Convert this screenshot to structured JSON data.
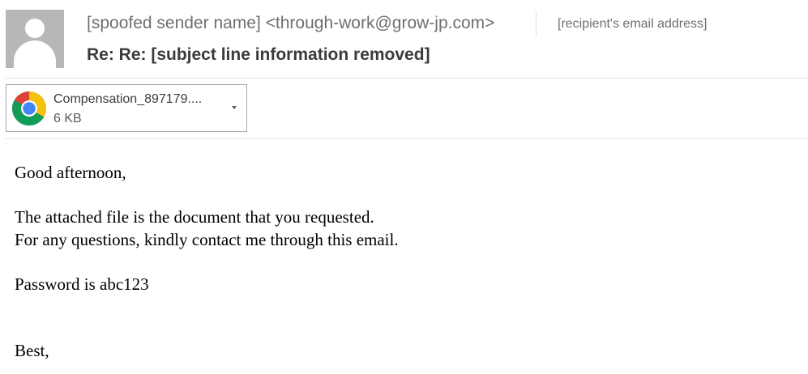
{
  "header": {
    "sender": "[spoofed sender name] <through-work@grow-jp.com>",
    "recipient": "[recipient's email address]",
    "subject": "Re: Re: [subject line information removed]"
  },
  "attachment": {
    "filename": "Compensation_897179....",
    "size": "6 KB",
    "icon": "chrome-icon"
  },
  "body": {
    "greeting": "Good afternoon,",
    "line1": "The attached file is the document that you requested.",
    "line2": "For any questions, kindly contact me through this email.",
    "password_line": "Password is abc123",
    "closing": "Best,"
  },
  "colors": {
    "avatar_bg": "#b7b7b7",
    "chrome_red": "#db4437",
    "chrome_yellow": "#f4c20d",
    "chrome_green": "#0f9d58",
    "chrome_blue": "#4285f4"
  }
}
